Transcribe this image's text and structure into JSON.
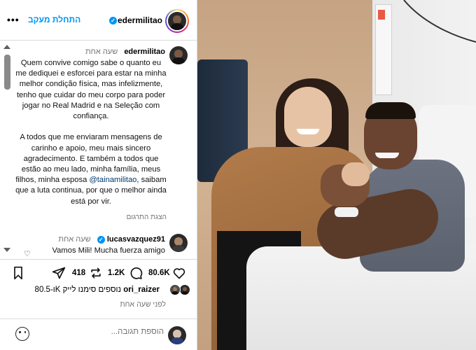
{
  "post": {
    "header": {
      "username": "edermilitao",
      "verified_icon": "verified-badge-icon",
      "follow_label": "התחלת מעקב",
      "more_icon": "more-options-icon"
    },
    "caption": {
      "username": "edermilitao",
      "time": "שעה אחת",
      "text_part1": "Quem convive comigo sabe o quanto eu me dediquei e esforcei para estar na minha melhor condição física, mas infelizmente, tenho que cuidar do meu corpo para poder jogar no Real Madrid e na Seleção com confiança.\n\nA todos que me enviaram mensagens de carinho e apoio, meu mais sincero agradecimento. E também a todos que estão ao meu lado, minha família, meus filhos, minha esposa ",
      "mention": "@tainamilitao",
      "text_part2": ", saibam que a luta continua, por que o melhor ainda está por vir.",
      "translate_label": "הצגת התרגום"
    },
    "reply": {
      "username": "lucasvazquez91",
      "time": "שעה אחת",
      "text": "Vamos Mili! Mucha fuerza amigo"
    },
    "actions": {
      "like_count": "80.6K",
      "comment_count": "1.2K",
      "repost_count": "418",
      "icons": [
        "heart-icon",
        "comment-icon",
        "repost-icon",
        "share-icon",
        "bookmark-icon"
      ]
    },
    "likes": {
      "liked_by": "ori_raizer",
      "others_text": "ו-80.5K נוספים סימנו לייק"
    },
    "time_posted": "לפני שעה אחת",
    "comment_box": {
      "placeholder": "הוספת תגובה..."
    }
  },
  "colors": {
    "accent": "#0095f6",
    "border": "#dbdbdb",
    "muted": "#737373"
  }
}
